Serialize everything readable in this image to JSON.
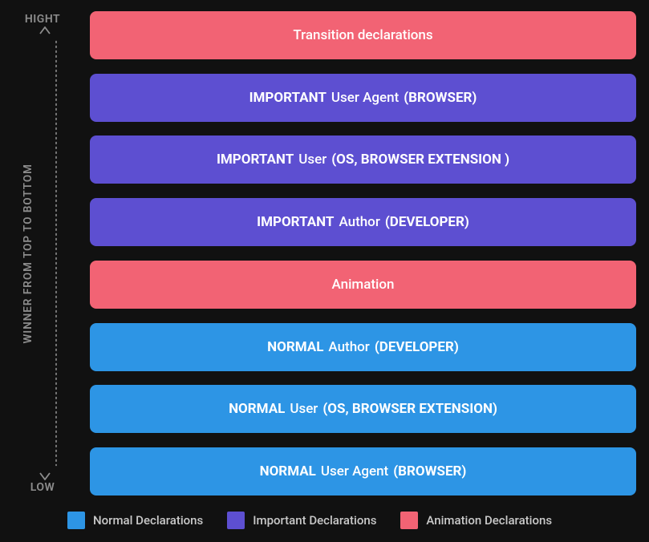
{
  "colors": {
    "normal": "#2d95e5",
    "important": "#5d4fd1",
    "animation": "#f26374",
    "axis": "#8d8d8d"
  },
  "axis": {
    "top": "HIGHT",
    "bottom": "LOW",
    "caption": "WINNER FROM TOP TO BOTTOM"
  },
  "bars": [
    {
      "colorKey": "animation",
      "pre": "",
      "main": "Transition declarations",
      "paren": ""
    },
    {
      "colorKey": "important",
      "pre": "IMPORTANT",
      "main": "User Agent",
      "paren": "(BROWSER)"
    },
    {
      "colorKey": "important",
      "pre": "IMPORTANT",
      "main": "User",
      "paren": "(OS, BROWSER EXTENSION )"
    },
    {
      "colorKey": "important",
      "pre": "IMPORTANT",
      "main": "Author",
      "paren": "(DEVELOPER)"
    },
    {
      "colorKey": "animation",
      "pre": "",
      "main": "Animation",
      "paren": ""
    },
    {
      "colorKey": "normal",
      "pre": "NORMAL",
      "main": "Author",
      "paren": "(DEVELOPER)"
    },
    {
      "colorKey": "normal",
      "pre": "NORMAL",
      "main": "User",
      "paren": "(OS, BROWSER EXTENSION)"
    },
    {
      "colorKey": "normal",
      "pre": "NORMAL",
      "main": "User Agent",
      "paren": "(BROWSER)"
    }
  ],
  "legend": [
    {
      "colorKey": "normal",
      "label": "Normal Declarations"
    },
    {
      "colorKey": "important",
      "label": "Important Declarations"
    },
    {
      "colorKey": "animation",
      "label": "Animation Declarations"
    }
  ]
}
